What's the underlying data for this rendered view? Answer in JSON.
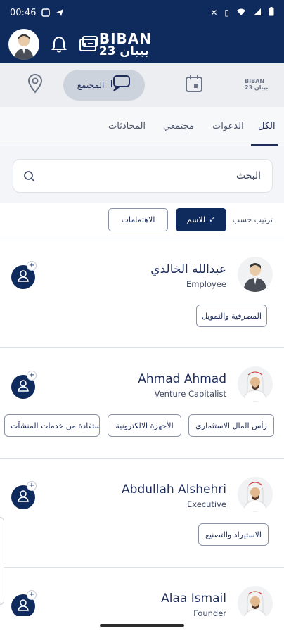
{
  "status_bar": {
    "time": "00:46"
  },
  "brand": {
    "top": "BIBAN",
    "bottom": "بيبان 23"
  },
  "nav": {
    "community_label": "المجتمع",
    "logo_top": "BIBAN",
    "logo_bottom": "بيبان 23"
  },
  "tabs": [
    {
      "label": "الكل",
      "active": true
    },
    {
      "label": "الدعوات",
      "active": false
    },
    {
      "label": "مجتمعي",
      "active": false
    },
    {
      "label": "المحادثات",
      "active": false
    }
  ],
  "search": {
    "placeholder": "البحث"
  },
  "sort": {
    "label": "ترتيب حسب",
    "by_name": "للاسم",
    "by_interests": "الاهتمامات"
  },
  "people": [
    {
      "name": "عبدالله الخالدي",
      "title": "Employee",
      "tags": [
        "المصرفية والتمويل"
      ]
    },
    {
      "name": "Ahmad Ahmad",
      "title": "Venture Capitalist",
      "tags": [
        "رأس المال الاستثماري",
        "الأجهزة الالكترونية",
        "الإستفادة من خدمات المنشآت"
      ]
    },
    {
      "name": "Abdullah Alshehri",
      "title": "Executive",
      "tags": [
        "الاستيراد والتصنيع"
      ]
    },
    {
      "name": "Alaa Ismail",
      "title": "Founder",
      "tags": []
    }
  ],
  "colors": {
    "primary": "#0f2a5c",
    "background": "#f4f5f8"
  }
}
